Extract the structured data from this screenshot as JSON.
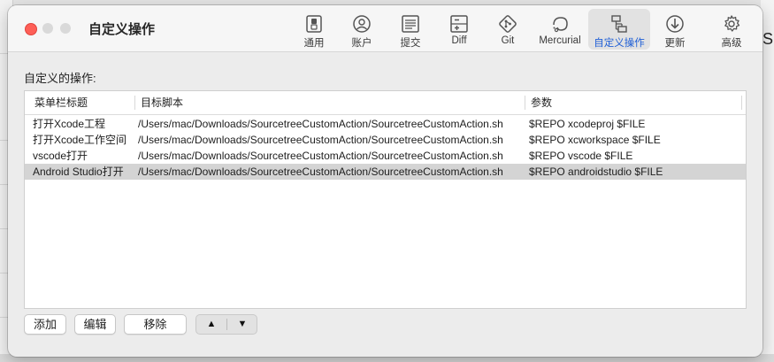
{
  "window": {
    "title": "自定义操作"
  },
  "toolbar": {
    "items": [
      {
        "label": "通用",
        "icon": "switch-icon"
      },
      {
        "label": "账户",
        "icon": "account-icon"
      },
      {
        "label": "提交",
        "icon": "commit-document-icon"
      },
      {
        "label": "Diff",
        "icon": "diff-icon"
      },
      {
        "label": "Git",
        "icon": "git-icon"
      },
      {
        "label": "Mercurial",
        "icon": "mercurial-icon"
      },
      {
        "label": "自定义操作",
        "icon": "custom-actions-icon",
        "active": true
      },
      {
        "label": "更新",
        "icon": "update-icon"
      },
      {
        "label": "高级",
        "icon": "gear-icon"
      }
    ]
  },
  "section": {
    "label": "自定义的操作:"
  },
  "table": {
    "headers": [
      "菜单栏标题",
      "目标脚本",
      "参数"
    ],
    "rows": [
      {
        "title": "打开Xcode工程",
        "script": "/Users/mac/Downloads/SourcetreeCustomAction/SourcetreeCustomAction.sh",
        "params": "$REPO xcodeproj $FILE"
      },
      {
        "title": "打开Xcode工作空间",
        "script": "/Users/mac/Downloads/SourcetreeCustomAction/SourcetreeCustomAction.sh",
        "params": "$REPO xcworkspace $FILE"
      },
      {
        "title": "vscode打开",
        "script": "/Users/mac/Downloads/SourcetreeCustomAction/SourcetreeCustomAction.sh",
        "params": "$REPO vscode  $FILE"
      },
      {
        "title": "Android Studio打开",
        "script": "/Users/mac/Downloads/SourcetreeCustomAction/SourcetreeCustomAction.sh",
        "params": "$REPO androidstudio $FILE",
        "selected": true
      }
    ]
  },
  "buttons": {
    "add": "添加",
    "edit": "编辑",
    "remove": "移除",
    "up": "▲",
    "down": "▼"
  },
  "background": {
    "right_letter": "S"
  },
  "colors": {
    "accent": "#1f5fd6",
    "close": "#fe5f57",
    "selected_row": "#d4d4d4"
  }
}
